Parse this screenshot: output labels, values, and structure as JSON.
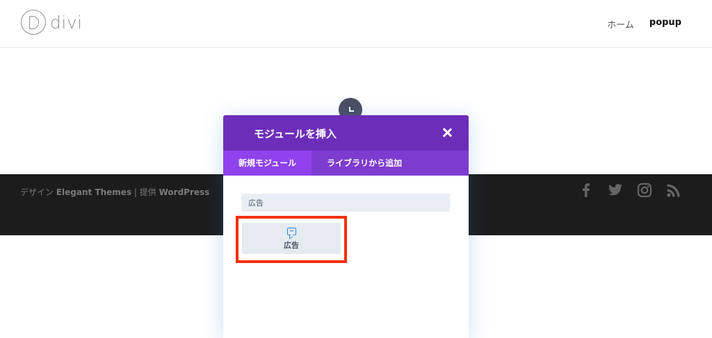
{
  "header": {
    "logo_text": "divi",
    "nav": [
      {
        "label": "ホーム"
      },
      {
        "label": "popup"
      }
    ]
  },
  "footer": {
    "credit_prefix": "デザイン",
    "credit_brand": "Elegant Themes",
    "credit_sep": " | 提供 ",
    "credit_platform": "WordPress",
    "social_icons": [
      "facebook-icon",
      "twitter-icon",
      "instagram-icon",
      "rss-icon"
    ],
    "icon_color": "#666666"
  },
  "modal": {
    "title": "モジュールを挿入",
    "tabs": [
      {
        "label": "新規モジュール",
        "active": true
      },
      {
        "label": "ライブラリから追加",
        "active": false
      }
    ],
    "search_value": "広告",
    "module": {
      "label": "広告",
      "icon": "comment-icon"
    },
    "colors": {
      "header": "#6c2eb9",
      "tabs": "#7e3bd0",
      "active_tab": "#8f42ec",
      "highlight": "#f2310e",
      "icon": "#2b87da"
    }
  }
}
